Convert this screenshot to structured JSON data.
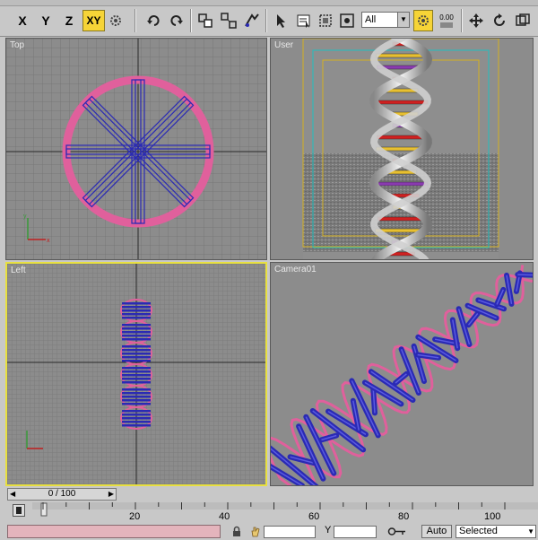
{
  "toolbar": {
    "axis_buttons": [
      "X",
      "Y",
      "Z",
      "XY"
    ],
    "active_axis": "XY",
    "selection_filter": "All",
    "counter_top": "0.00"
  },
  "viewports": {
    "top": {
      "label": "Top"
    },
    "user": {
      "label": "User"
    },
    "left": {
      "label": "Left"
    },
    "camera": {
      "label": "Camera01"
    }
  },
  "timeline": {
    "frame_display": "0 / 100",
    "ticks": [
      "20",
      "40",
      "60",
      "80",
      "100"
    ]
  },
  "status": {
    "y_label": "Y",
    "auto_label": "Auto",
    "selected_label": "Selected"
  },
  "colors": {
    "viewport_bg": "#8c8c8c",
    "active_border": "#e8e040",
    "ring_pink": "#e0609c",
    "spoke_blue": "#2a2ab4",
    "accent_yellow": "#f6d437"
  }
}
